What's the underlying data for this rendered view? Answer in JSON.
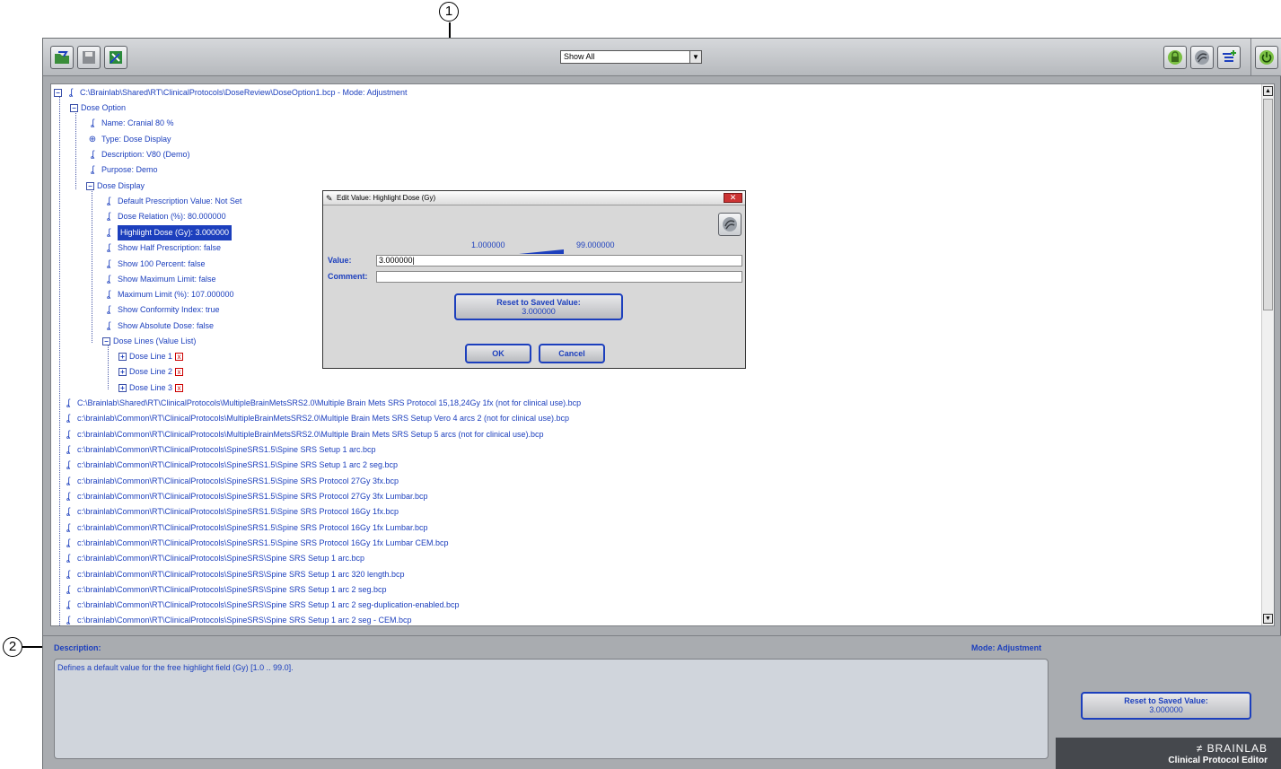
{
  "callouts": {
    "one": "1",
    "two": "2"
  },
  "toolbar": {
    "filter_value": "Show All",
    "filter_arrow": "▼"
  },
  "tree": {
    "root_path": "C:\\Brainlab\\Shared\\RT\\ClinicalProtocols\\DoseReview\\DoseOption1.bcp - Mode: Adjustment",
    "dose_option": "Dose Option",
    "name": "Name: Cranial 80 %",
    "type": "Type: Dose Display",
    "description": "Description: V80 (Demo)",
    "purpose": "Purpose: Demo",
    "dose_display": "Dose Display",
    "default_prescription": "Default Prescription Value: Not Set",
    "dose_relation": "Dose Relation (%): 80.000000",
    "highlight_dose": "Highlight Dose (Gy): 3.000000",
    "show_half": "Show Half Prescription: false",
    "show_100": "Show 100 Percent: false",
    "show_max": "Show Maximum Limit: false",
    "max_limit": "Maximum Limit (%): 107.000000",
    "show_conformity": "Show Conformity Index: true",
    "show_absolute": "Show Absolute Dose: false",
    "dose_lines": "Dose Lines (Value List)",
    "dose_line_1": "Dose Line 1",
    "dose_line_2": "Dose Line 2",
    "dose_line_3": "Dose Line 3",
    "files": [
      "C:\\Brainlab\\Shared\\RT\\ClinicalProtocols\\MultipleBrainMetsSRS2.0\\Multiple Brain Mets SRS Protocol 15,18,24Gy 1fx (not for clinical use).bcp",
      "c:\\brainlab\\Common\\RT\\ClinicalProtocols\\MultipleBrainMetsSRS2.0\\Multiple Brain Mets SRS Setup Vero 4 arcs 2 (not for clinical use).bcp",
      "c:\\brainlab\\Common\\RT\\ClinicalProtocols\\MultipleBrainMetsSRS2.0\\Multiple Brain Mets SRS Setup 5 arcs (not for clinical use).bcp",
      "c:\\brainlab\\Common\\RT\\ClinicalProtocols\\SpineSRS1.5\\Spine SRS Setup 1 arc.bcp",
      "c:\\brainlab\\Common\\RT\\ClinicalProtocols\\SpineSRS1.5\\Spine SRS Setup 1 arc 2 seg.bcp",
      "c:\\brainlab\\Common\\RT\\ClinicalProtocols\\SpineSRS1.5\\Spine SRS Protocol 27Gy 3fx.bcp",
      "c:\\brainlab\\Common\\RT\\ClinicalProtocols\\SpineSRS1.5\\Spine SRS Protocol 27Gy 3fx Lumbar.bcp",
      "c:\\brainlab\\Common\\RT\\ClinicalProtocols\\SpineSRS1.5\\Spine SRS Protocol 16Gy 1fx.bcp",
      "c:\\brainlab\\Common\\RT\\ClinicalProtocols\\SpineSRS1.5\\Spine SRS Protocol 16Gy 1fx Lumbar.bcp",
      "c:\\brainlab\\Common\\RT\\ClinicalProtocols\\SpineSRS1.5\\Spine SRS Protocol 16Gy 1fx Lumbar CEM.bcp",
      "c:\\brainlab\\Common\\RT\\ClinicalProtocols\\SpineSRS\\Spine SRS Setup 1 arc.bcp",
      "c:\\brainlab\\Common\\RT\\ClinicalProtocols\\SpineSRS\\Spine SRS Setup 1 arc 320 length.bcp",
      "c:\\brainlab\\Common\\RT\\ClinicalProtocols\\SpineSRS\\Spine SRS Setup 1 arc 2 seg.bcp",
      "c:\\brainlab\\Common\\RT\\ClinicalProtocols\\SpineSRS\\Spine SRS Setup 1 arc 2 seg-duplication-enabled.bcp",
      "c:\\brainlab\\Common\\RT\\ClinicalProtocols\\SpineSRS\\Spine SRS Setup 1 arc 2 seg - CEM.bcp"
    ]
  },
  "dialog": {
    "title": "Edit Value: Highlight Dose (Gy)",
    "range_min": "1.000000",
    "range_max": "99.000000",
    "value_label": "Value:",
    "value": "3.000000",
    "comment_label": "Comment:",
    "comment": "",
    "reset_label": "Reset to Saved Value:",
    "reset_value": "3.000000",
    "ok": "OK",
    "cancel": "Cancel",
    "close": "✕"
  },
  "bottom": {
    "description_label": "Description:",
    "mode_label": "Mode: Adjustment",
    "description_text": "Defines a default value for the free highlight field (Gy) [1.0 .. 99.0].",
    "reset_label": "Reset to Saved Value:",
    "reset_value": "3.000000"
  },
  "brand": {
    "logo": "BRAINLAB",
    "product": "Clinical Protocol Editor"
  },
  "colors": {
    "accent": "#1c3fbd",
    "frame": "#a9acb0",
    "brand_bg": "#45484d"
  }
}
